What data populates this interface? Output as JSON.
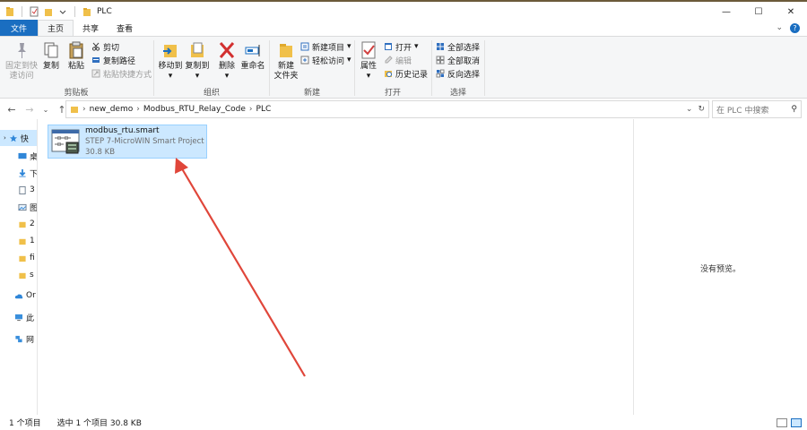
{
  "window": {
    "title": "PLC",
    "minimize": "—",
    "maximize": "☐",
    "close": "✕"
  },
  "tabs": {
    "file": "文件",
    "home": "主页",
    "share": "共享",
    "view": "查看",
    "expand": "⌄",
    "help": "?"
  },
  "ribbon": {
    "clipboard": {
      "label": "剪贴板",
      "pin": [
        "固定到快",
        "速访问"
      ],
      "copy": "复制",
      "paste": "粘贴",
      "cut": "剪切",
      "copy_path": "复制路径",
      "paste_shortcut": "粘贴快捷方式"
    },
    "organize": {
      "label": "组织",
      "move_to": "移动到",
      "copy_to": "复制到",
      "delete": "删除",
      "rename": "重命名"
    },
    "new": {
      "label": "新建",
      "new_folder": [
        "新建",
        "文件夹"
      ],
      "new_item": "新建项目",
      "easy_access": "轻松访问"
    },
    "open": {
      "label": "打开",
      "properties": "属性",
      "open": "打开",
      "edit": "编辑",
      "history": "历史记录"
    },
    "select": {
      "label": "选择",
      "select_all": "全部选择",
      "select_none": "全部取消",
      "invert": "反向选择"
    }
  },
  "address": {
    "crumbs": [
      "new_demo",
      "Modbus_RTU_Relay_Code",
      "PLC"
    ],
    "search_placeholder": "在 PLC 中搜索"
  },
  "nav": {
    "items": [
      "快",
      "桌",
      "下",
      "3",
      "图",
      "2",
      "1",
      "fi",
      "s",
      "Or",
      "此",
      "网"
    ]
  },
  "file": {
    "name": "modbus_rtu.smart",
    "type": "STEP 7-MicroWIN Smart Project",
    "size": "30.8 KB"
  },
  "preview": {
    "empty_text": "没有预览。"
  },
  "status": {
    "count": "1 个项目",
    "selection": "选中 1 个项目  30.8 KB"
  },
  "colors": {
    "accent": "#1a6ec1",
    "selection": "#cce8ff",
    "arrow": "#e0463a"
  }
}
